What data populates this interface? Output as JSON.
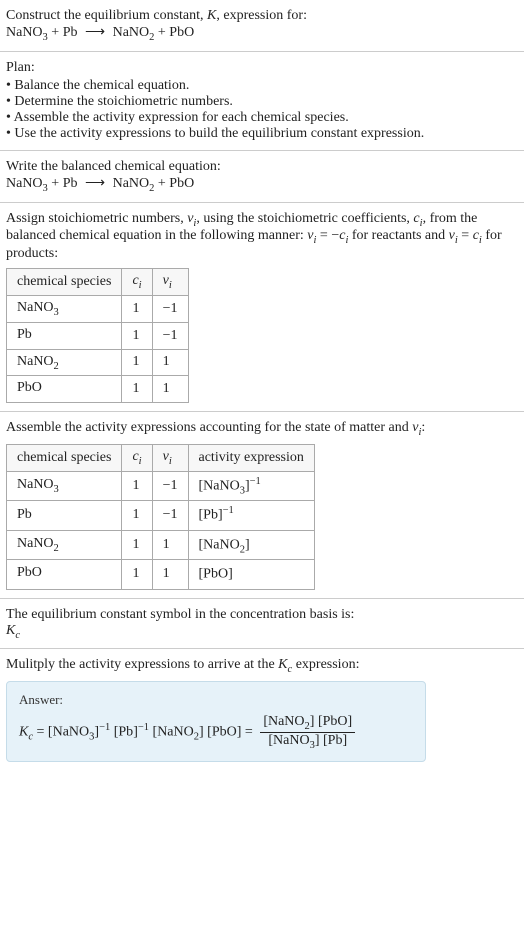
{
  "header": {
    "prompt_line": "Construct the equilibrium constant, K, expression for:"
  },
  "reaction": {
    "lhs_a": "NaNO",
    "lhs_a_sub": "3",
    "plus1": " + ",
    "lhs_b": "Pb",
    "arrow": " ⟶ ",
    "rhs_a": "NaNO",
    "rhs_a_sub": "2",
    "plus2": " + ",
    "rhs_b": "PbO"
  },
  "plan": {
    "title": "Plan:",
    "items": [
      "Balance the chemical equation.",
      "Determine the stoichiometric numbers.",
      "Assemble the activity expression for each chemical species.",
      "Use the activity expressions to build the equilibrium constant expression."
    ]
  },
  "balanced_heading": "Write the balanced chemical equation:",
  "stoich": {
    "intro_a": "Assign stoichiometric numbers, ",
    "nu_i": "ν",
    "sub_i": "i",
    "intro_b": ", using the stoichiometric coefficients, ",
    "c_i": "c",
    "intro_c": ", from the balanced chemical equation in the following manner: ",
    "rel1a": "ν",
    "rel1b": " = −",
    "rel1c": "c",
    "rel1d": " for reactants and ",
    "rel2a": "ν",
    "rel2b": " = ",
    "rel2c": "c",
    "rel2d": " for products:",
    "headers": {
      "h1": "chemical species",
      "h2": "c",
      "h2sub": "i",
      "h3": "ν",
      "h3sub": "i"
    },
    "rows": [
      {
        "name": "NaNO",
        "name_sub": "3",
        "c": "1",
        "nu": "−1"
      },
      {
        "name": "Pb",
        "name_sub": "",
        "c": "1",
        "nu": "−1"
      },
      {
        "name": "NaNO",
        "name_sub": "2",
        "c": "1",
        "nu": "1"
      },
      {
        "name": "PbO",
        "name_sub": "",
        "c": "1",
        "nu": "1"
      }
    ]
  },
  "activity": {
    "intro": "Assemble the activity expressions accounting for the state of matter and ",
    "nu": "ν",
    "sub_i": "i",
    "colon": ":",
    "headers": {
      "h1": "chemical species",
      "h2": "c",
      "h2sub": "i",
      "h3": "ν",
      "h3sub": "i",
      "h4": "activity expression"
    },
    "rows": [
      {
        "name": "NaNO",
        "name_sub": "3",
        "c": "1",
        "nu": "−1",
        "expr_open": "[NaNO",
        "expr_sub": "3",
        "expr_close": "]",
        "expr_pow": "−1"
      },
      {
        "name": "Pb",
        "name_sub": "",
        "c": "1",
        "nu": "−1",
        "expr_open": "[Pb",
        "expr_sub": "",
        "expr_close": "]",
        "expr_pow": "−1"
      },
      {
        "name": "NaNO",
        "name_sub": "2",
        "c": "1",
        "nu": "1",
        "expr_open": "[NaNO",
        "expr_sub": "2",
        "expr_close": "]",
        "expr_pow": ""
      },
      {
        "name": "PbO",
        "name_sub": "",
        "c": "1",
        "nu": "1",
        "expr_open": "[PbO",
        "expr_sub": "",
        "expr_close": "]",
        "expr_pow": ""
      }
    ]
  },
  "kc_symbol": {
    "line": "The equilibrium constant symbol in the concentration basis is:",
    "K": "K",
    "c": "c"
  },
  "multiply": {
    "line_a": "Mulitply the activity expressions to arrive at the ",
    "K": "K",
    "c": "c",
    "line_b": " expression:"
  },
  "answer": {
    "label": "Answer:",
    "K": "K",
    "c": "c",
    "eq": " = ",
    "t1_open": "[NaNO",
    "t1_sub": "3",
    "t1_close": "]",
    "t1_pow": "−1",
    "sp1": " ",
    "t2_open": "[Pb",
    "t2_close": "]",
    "t2_pow": "−1",
    "sp2": " ",
    "t3_open": "[NaNO",
    "t3_sub": "2",
    "t3_close": "]",
    "sp3": " ",
    "t4_open": "[PbO",
    "t4_close": "]",
    "eq2": " = ",
    "num_a": "[NaNO",
    "num_a_sub": "2",
    "num_a_close": "] [PbO]",
    "den_a": "[NaNO",
    "den_a_sub": "3",
    "den_a_close": "] [Pb]"
  }
}
